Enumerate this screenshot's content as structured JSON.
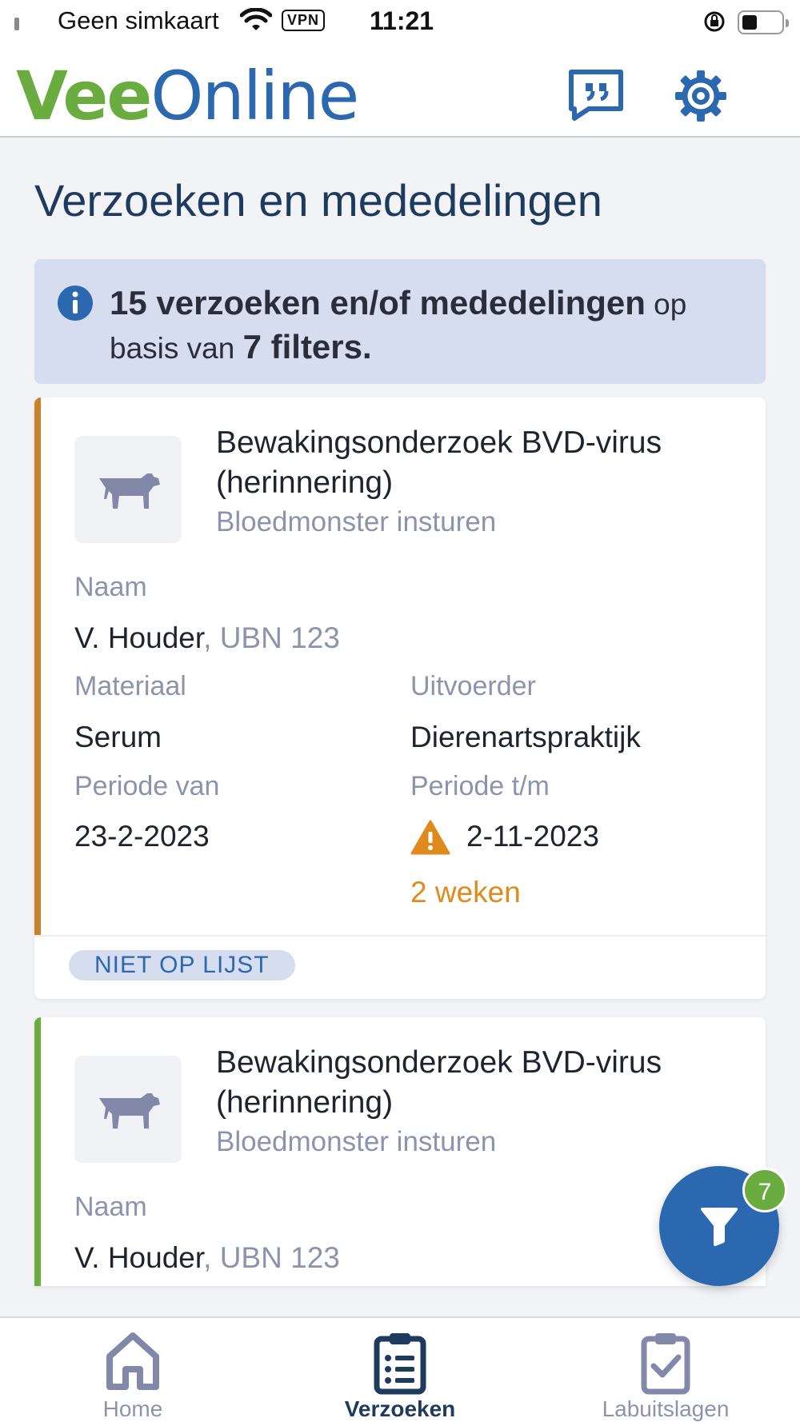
{
  "status_bar": {
    "carrier": "Geen simkaart",
    "vpn": "VPN",
    "time": "11:21"
  },
  "header": {
    "logo_part1": "Vee",
    "logo_part2": "Online",
    "feedback_icon": "quote-bubble-icon",
    "settings_icon": "gear-icon"
  },
  "page": {
    "title": "Verzoeken en mededelingen"
  },
  "info_banner": {
    "count": "15 verzoeken en/of mededelingen",
    "text_mid1": " op",
    "text_mid2": "basis van ",
    "filters": "7 filters."
  },
  "cards": [
    {
      "accent_color": "#c9822a",
      "icon": "cow-icon",
      "title": "Bewakingsonderzoek BVD-virus (herinnering)",
      "subtitle": "Bloedmonster insturen",
      "naam_label": "Naam",
      "naam_value": "V. Houder",
      "ubn": ", UBN 123",
      "materiaal_label": "Materiaal",
      "materiaal_value": "Serum",
      "uitvoerder_label": "Uitvoerder",
      "uitvoerder_value": "Dierenartspraktijk",
      "periode_van_label": "Periode van",
      "periode_van_value": "23-2-2023",
      "periode_tm_label": "Periode t/m",
      "periode_tm_value": "2-11-2023",
      "warning_text": "2 weken",
      "status_badge": "NIET OP LIJST"
    },
    {
      "accent_color": "#6aac3f",
      "icon": "cow-icon",
      "title": "Bewakingsonderzoek BVD-virus (herinnering)",
      "subtitle": "Bloedmonster insturen",
      "naam_label": "Naam",
      "naam_value": "V. Houder",
      "ubn": ", UBN 123"
    }
  ],
  "filter_fab": {
    "icon": "filter-icon",
    "badge": "7"
  },
  "bottom_nav": {
    "items": [
      {
        "label": "Home",
        "icon": "home-icon",
        "active": false
      },
      {
        "label": "Verzoeken",
        "icon": "clipboard-list-icon",
        "active": true
      },
      {
        "label": "Labuitslagen",
        "icon": "clipboard-check-icon",
        "active": false
      }
    ]
  },
  "colors": {
    "brand_blue": "#2b68b0",
    "brand_green": "#6aac3f",
    "warning_orange": "#e08a1e"
  }
}
